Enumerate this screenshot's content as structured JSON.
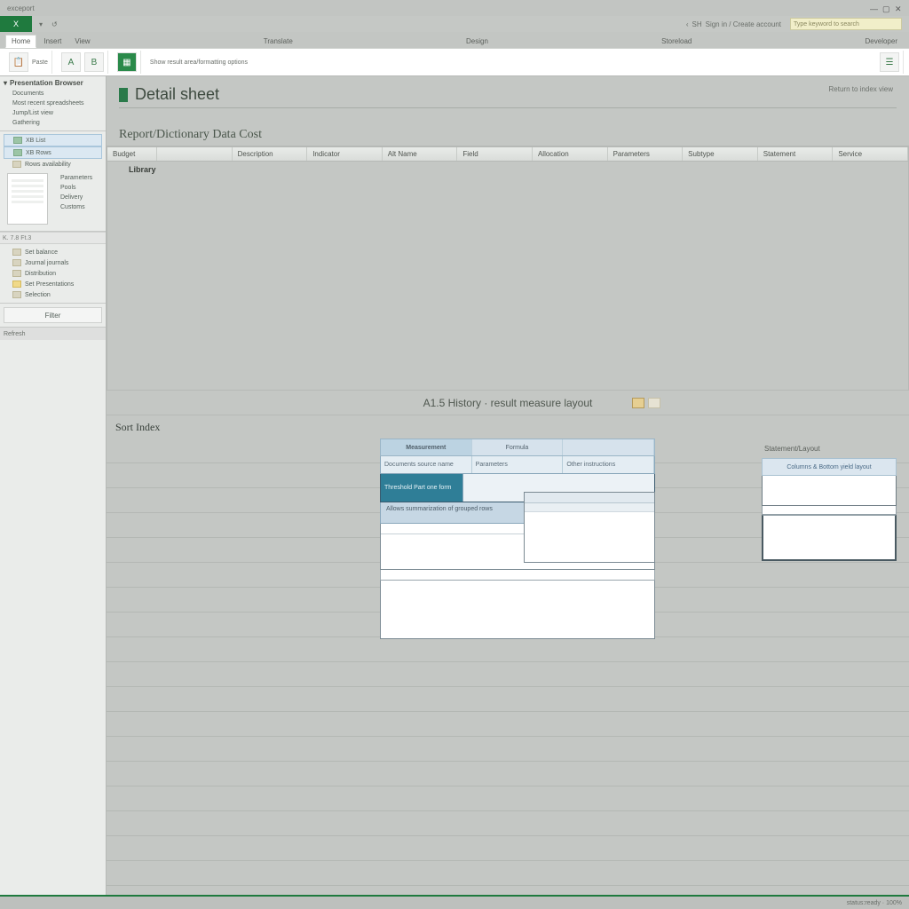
{
  "window": {
    "title": "exceport",
    "min_label": "—",
    "max_label": "▢",
    "close_label": "✕"
  },
  "appbar": {
    "brand": "X",
    "nav_back": "‹",
    "nav_text": "SH",
    "signin": "Sign in / Create account",
    "search_placeholder": "Type keyword to search"
  },
  "tabs": {
    "items": [
      "Home",
      "Insert",
      "View",
      "",
      "",
      "Translate",
      "",
      "Design",
      "",
      "",
      "Storeload",
      "",
      "",
      "",
      "",
      "Developer"
    ],
    "active_index": 0
  },
  "ribbon": {
    "paste": "Paste",
    "long_text": "Show result area/formatting options"
  },
  "sidebar": {
    "sec1": {
      "title": "Presentation Browser",
      "items": [
        "Documents",
        "Most recent spreadsheets",
        "Jump/List view",
        "Gathering"
      ]
    },
    "sec2": {
      "items": [
        "XB List",
        "XB Rows",
        "Rows availability"
      ]
    },
    "sec3": {
      "items": [
        "Parameters",
        "Pools",
        "Delivery",
        "Customs"
      ]
    },
    "toolbar": "K. 7.8 Ft.3",
    "sec4": {
      "items": [
        "Set balance",
        "Journal journals",
        "Distribution",
        "Set Presentations",
        "Selection"
      ]
    },
    "button": "Filter",
    "foot": "Refresh"
  },
  "doc": {
    "title": "Detail sheet",
    "side": "Return to index view",
    "subtitle": "Report/Dictionary Data Cost",
    "headers": [
      "Budget",
      "",
      "Description",
      "Indicator",
      "Alt Name",
      "Field",
      "Allocation",
      "Parameters",
      "Subtype",
      "Statement",
      "Service"
    ],
    "body_tag": "Library",
    "caption": "A1.5 History · result measure layout"
  },
  "lower": {
    "left_head": "Sort Index",
    "right_head": "Statement/Layout",
    "center": {
      "tabs": [
        "Measurement",
        "Formula",
        ""
      ],
      "sub": [
        "Documents source name",
        "Parameters",
        "Other instructions"
      ],
      "band1a": "Threshold\nPart one form",
      "info": "Allows summarization of grouped rows"
    },
    "right": {
      "head": "Statement/Layout",
      "sub": "Columns & Bottom   yield layout"
    }
  },
  "status": {
    "text": "status:ready · 100%"
  },
  "colors": {
    "accent": "#1f7a3e",
    "teal": "#2f7e97",
    "panel_blue": "#bcd3e2"
  }
}
